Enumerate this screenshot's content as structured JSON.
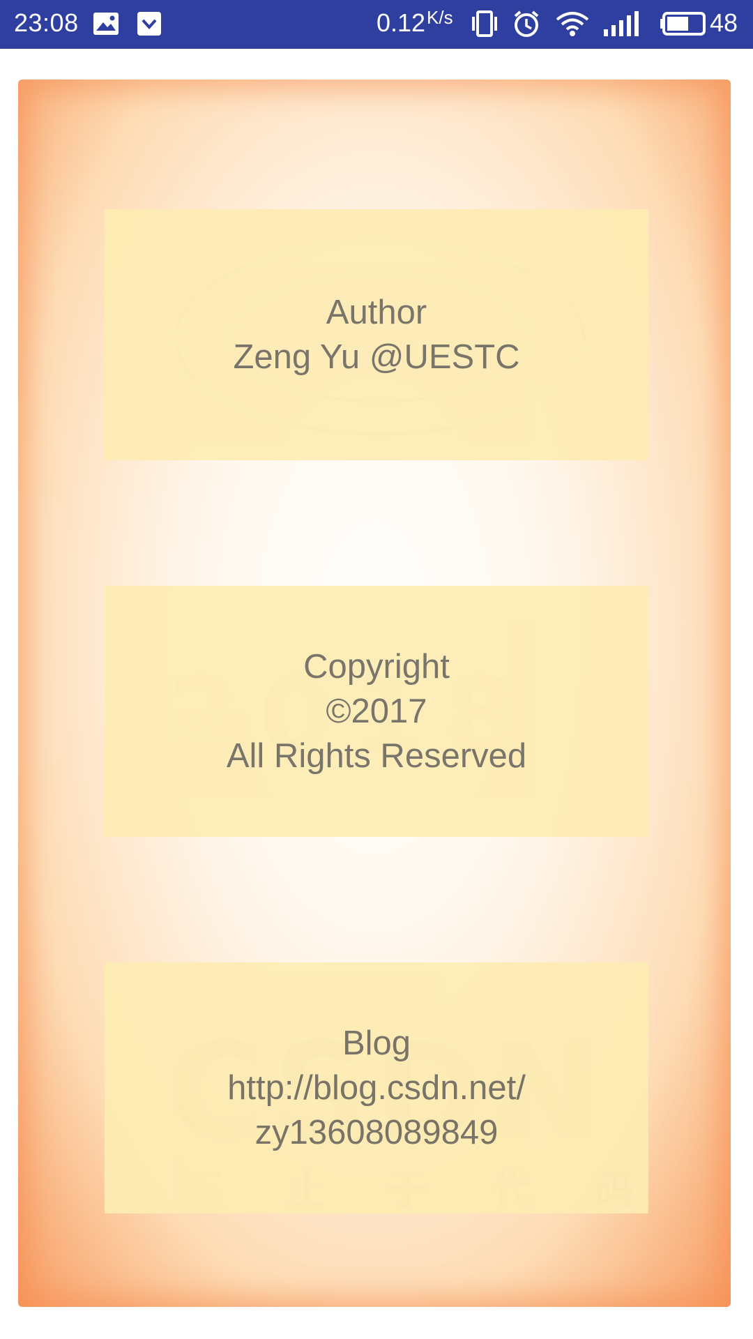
{
  "status_bar": {
    "time": "23:08",
    "net_speed": "0.12",
    "net_speed_unit": "K/s",
    "battery_percent": "48",
    "icons": [
      "gallery-icon",
      "download-icon",
      "vibrate-icon",
      "alarm-icon",
      "wifi-icon",
      "signal-icon",
      "battery-icon"
    ]
  },
  "cards": {
    "author": {
      "line1": "Author",
      "line2": "Zeng Yu @UESTC"
    },
    "copyright": {
      "line1": "Copyright",
      "line2": "©2017",
      "line3": "All Rights Reserved"
    },
    "blog": {
      "line1": "Blog",
      "line2": "http://blog.csdn.net/",
      "line3": "zy13608089849"
    }
  },
  "watermarks": {
    "seal_text": "UESTC",
    "year_text": "2018",
    "brand_text": "CSDN",
    "slogan_text": "不止于代码"
  },
  "colors": {
    "status_bar_bg": "#2e3f9f",
    "card_bg": "#fdecb3",
    "text": "#6e6a60",
    "paper_edge": "#f7965a"
  }
}
